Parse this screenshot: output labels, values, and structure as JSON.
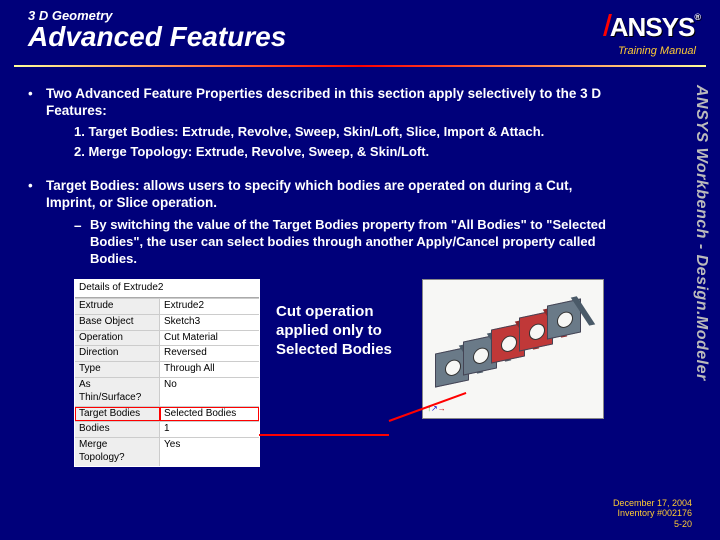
{
  "header": {
    "subtitle": "3 D Geometry",
    "title": "Advanced Features",
    "logo_text": "ANSYS",
    "tm": "®",
    "training_label": "Training Manual"
  },
  "vertical_label": "ANSYS Workbench - Design.Modeler",
  "bullets": {
    "b1": "Two Advanced Feature Properties described in this section apply selectively to the 3 D Features:",
    "b1_sub1": "1.  Target Bodies: Extrude, Revolve, Sweep, Skin/Loft, Slice, Import & Attach.",
    "b1_sub2": "2.  Merge Topology: Extrude, Revolve, Sweep, & Skin/Loft.",
    "b2": "Target Bodies: allows users to specify which bodies are operated on during a Cut, Imprint, or Slice operation.",
    "b2_sub": "By switching the value of the Target Bodies property from \"All Bodies\" to \"Selected Bodies\", the user can select bodies through another Apply/Cancel property called Bodies."
  },
  "details": {
    "header": "Details of Extrude2",
    "rows": [
      {
        "k": "Extrude",
        "v": "Extrude2"
      },
      {
        "k": "Base Object",
        "v": "Sketch3"
      },
      {
        "k": "Operation",
        "v": "Cut Material"
      },
      {
        "k": "Direction",
        "v": "Reversed"
      },
      {
        "k": "Type",
        "v": "Through All"
      },
      {
        "k": "As Thin/Surface?",
        "v": "No"
      },
      {
        "k": "Target Bodies",
        "v": "Selected Bodies",
        "hl": true
      },
      {
        "k": "Bodies",
        "v": "1"
      },
      {
        "k": "Merge Topology?",
        "v": "Yes"
      }
    ]
  },
  "callout": "Cut operation applied only to Selected Bodies",
  "footer": {
    "date": "December 17, 2004",
    "inv": "Inventory #002176",
    "page": "5-20"
  }
}
